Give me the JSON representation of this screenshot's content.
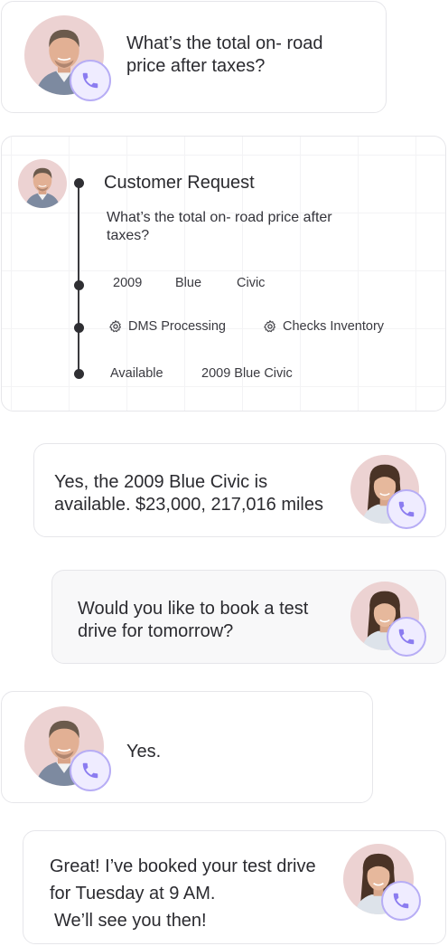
{
  "messages": [
    {
      "id": "m1",
      "speaker": "customer",
      "text": "What’s the total on- road price after taxes?"
    },
    {
      "id": "m3",
      "speaker": "agent",
      "text": "Yes, the 2009 Blue Civic is available. $23,000, 217,016 miles"
    },
    {
      "id": "m4",
      "speaker": "agent",
      "text": "Would you like to book a test drive for tomorrow?"
    },
    {
      "id": "m5",
      "speaker": "customer",
      "text": "Yes."
    },
    {
      "id": "m6",
      "speaker": "agent",
      "line1": "Great! I’ve booked your test drive",
      "line2": "for Tuesday at 9 AM.",
      "line3": "We’ll see you then!"
    }
  ],
  "request_card": {
    "title": "Customer Request",
    "description": "What’s the total on- road price after taxes?",
    "tags": [
      "2009",
      "Blue",
      "Civic"
    ],
    "actions": [
      {
        "label": "DMS Processing",
        "icon": "gear-icon"
      },
      {
        "label": "Checks Inventory",
        "icon": "gear-icon"
      }
    ],
    "results": [
      "Available",
      "2009 Blue Civic"
    ]
  },
  "colors": {
    "badge_border": "#b7adf5",
    "badge_fill": "#efecff",
    "phone_icon": "#8b7cf0",
    "card_border": "#e6e6ea"
  }
}
